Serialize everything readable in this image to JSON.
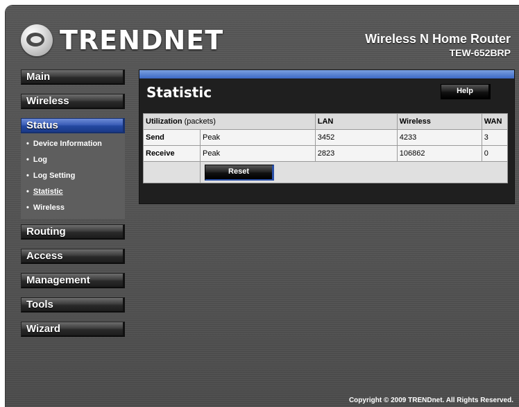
{
  "header": {
    "logo_text": "TRENDNET",
    "product_name": "Wireless N Home Router",
    "model": "TEW-652BRP"
  },
  "sidebar": {
    "items": [
      {
        "label": "Main"
      },
      {
        "label": "Wireless"
      },
      {
        "label": "Status",
        "active": true
      },
      {
        "label": "Routing"
      },
      {
        "label": "Access"
      },
      {
        "label": "Management"
      },
      {
        "label": "Tools"
      },
      {
        "label": "Wizard"
      }
    ],
    "status_submenu": [
      {
        "label": "Device Information"
      },
      {
        "label": "Log"
      },
      {
        "label": "Log Setting"
      },
      {
        "label": "Statistic",
        "current": true
      },
      {
        "label": "Wireless"
      }
    ],
    "bullet": "•"
  },
  "main": {
    "title": "Statistic",
    "help_label": "Help",
    "table": {
      "header": {
        "col1_bold": "Utilization",
        "col1_thin": " (packets)",
        "lan": "LAN",
        "wireless": "Wireless",
        "wan": "WAN"
      },
      "rows": [
        {
          "label": "Send",
          "type": "Peak",
          "lan": "3452",
          "wireless": "4233",
          "wan": "3"
        },
        {
          "label": "Receive",
          "type": "Peak",
          "lan": "2823",
          "wireless": "106862",
          "wan": "0"
        }
      ]
    },
    "reset_label": "Reset"
  },
  "footer": {
    "copyright": "Copyright © 2009 TRENDnet. All Rights Reserved."
  },
  "colors": {
    "accent_blue": "#2448a0",
    "panel_top_blue": "#3c69c4",
    "background": "#505050"
  }
}
